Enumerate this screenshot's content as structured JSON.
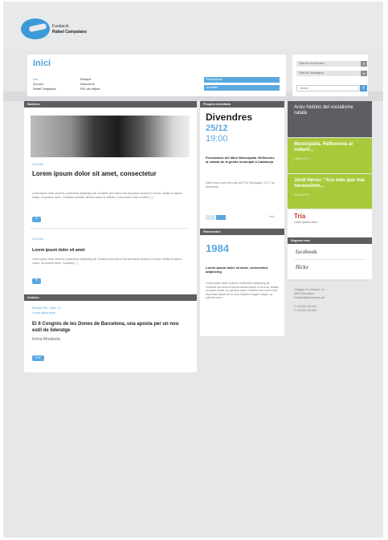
{
  "header": {
    "org_line1": "Fundació",
    "org_line2": "Rafael Campalans"
  },
  "top": {
    "title": "Inici",
    "links_col1": [
      "Inici",
      "Qui som",
      "Rafael Campalans"
    ],
    "links_col2": [
      "Enllaços",
      "Subscriu-te",
      "FRC als mitjans"
    ],
    "btn_publications": "Publicacions",
    "btn_activities": "Activitats"
  },
  "search": {
    "select1": "Totes les Col·leccions",
    "select2": "Totes les Temàtiques",
    "input_placeholder": "Cercar...",
    "arrow": "▾"
  },
  "news": {
    "header": "Notícies",
    "item1": {
      "date": "12/12/08",
      "title": "Lorem ipsum dolor sit amet, consectetur",
      "body": "Lorem ipsum dolor sit amet, consectetur adipiscing elit. Curabitur sed erat ut erat accumsan dictum eu et urna. Nullam et sapien neque, ac pulvinar lorem. Curabitur convallis ultricies massa in ultricies. Lorem ipsum dolor sit amet. [...]"
    },
    "item2": {
      "date": "12/12/08",
      "title": "Lorem ipsum dolor sit amet",
      "body": "Lorem ipsum dolor sit amet, consectetur adipiscing elit. Curabitur sed erat ut erat accumsan dictum eu et urna. Nullam et sapien neque, ac pulvinar lorem. Curabitur [...]"
    },
    "plus": "+"
  },
  "articles": {
    "header": "Articles",
    "meta1": "Revista FRC / Núm. 27",
    "meta2": "Lorem ipsum dolor",
    "title": "El II Congrés de les Dones de Barcelona, una aposta per un nou estil de lideratge",
    "author": "Imma Moraleda",
    "btn": "PDF"
  },
  "events": {
    "header": "Propers Activitats",
    "day": "Divendres",
    "date": "25/12",
    "time": "19:00",
    "title": "Presentació del llibre Municipàlia. Reflexions al voltant de la gestió municipal a Catalunya",
    "place": "Sala Ernest Lluch de la seu del PSC (Nicaragua, 75-77, de Barcelona)",
    "more": "+info"
  },
  "ephemerides": {
    "header": "Efemèrides",
    "year": "1984",
    "title": "Lorem ipsum dolor sit amet, consectetur adipiscing",
    "body": "Lorem ipsum dolor sit amet, consectetur adipiscing elit. Curabitur sed erat ut erat accumsan dictum eu et urna. Nullam et sapien neque, ac pulvinar lorem. Curabitur sed erat ut erat accumsan dictum eu et urna. Nullam et sapien neque, ac pulvinar lorem."
  },
  "right": {
    "tile1": "Arxiu històric del socialisme català",
    "tile2_title": "Municipàlia. Reflexions al voltant...",
    "tile2_sub": "Llibres FRC",
    "tile3_title": "Jordi Hereu: “Ara més que mai necessitem...",
    "tile3_sub": "Revista FRC",
    "tile4_title": "Tria",
    "tile4_sub": "Lorem ipsum dolor",
    "follow_header": "Segueix-nos",
    "facebook": "facebook",
    "flickr": "flickr",
    "addr1": "Trafalgar, 12, entresòl, 1a",
    "addr2": "08010 Barcelona",
    "addr3": "fundacio@fcampalans.cat",
    "addr4": "T +34 933 195 412",
    "addr5": "F +34 933 199 844"
  },
  "colors": {
    "accent": "#4d9fd9",
    "green": "#a8c93a",
    "dark": "#5c5e61",
    "red": "#c8372d"
  }
}
